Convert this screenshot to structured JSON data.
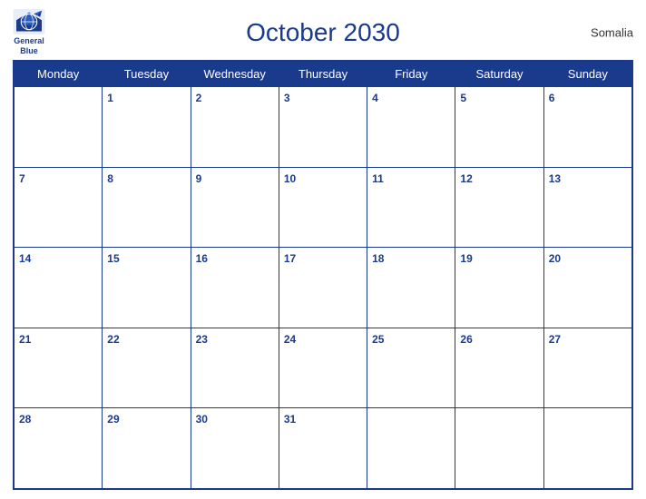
{
  "header": {
    "title": "October 2030",
    "country": "Somalia",
    "logo_line1": "General",
    "logo_line2": "Blue"
  },
  "days_of_week": [
    "Monday",
    "Tuesday",
    "Wednesday",
    "Thursday",
    "Friday",
    "Saturday",
    "Sunday"
  ],
  "weeks": [
    [
      "",
      "1",
      "2",
      "3",
      "4",
      "5",
      "6"
    ],
    [
      "7",
      "8",
      "9",
      "10",
      "11",
      "12",
      "13"
    ],
    [
      "14",
      "15",
      "16",
      "17",
      "18",
      "19",
      "20"
    ],
    [
      "21",
      "22",
      "23",
      "24",
      "25",
      "26",
      "27"
    ],
    [
      "28",
      "29",
      "30",
      "31",
      "",
      "",
      ""
    ]
  ]
}
